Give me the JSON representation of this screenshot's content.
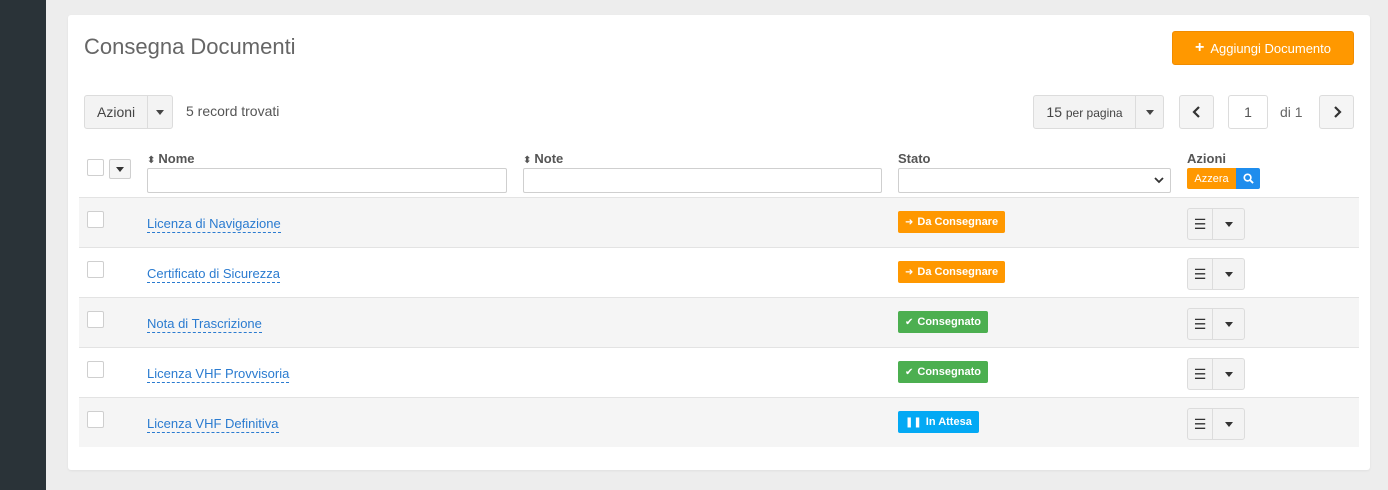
{
  "header": {
    "title": "Consegna Documenti",
    "add_button_label": "Aggiungi Documento"
  },
  "toolbar": {
    "actions_label": "Azioni",
    "records_text": "5 record trovati",
    "per_page_number": "15",
    "per_page_text": "per pagina",
    "page_value": "1",
    "page_of": "di 1"
  },
  "table": {
    "columns": {
      "name": "Nome",
      "note": "Note",
      "status": "Stato",
      "actions": "Azioni"
    },
    "reset_label": "Azzera",
    "rows": [
      {
        "name": "Licenza di Navigazione",
        "status": "Da Consegnare",
        "status_type": "pending"
      },
      {
        "name": "Certificato di Sicurezza",
        "status": "Da Consegnare",
        "status_type": "pending"
      },
      {
        "name": "Nota di Trascrizione",
        "status": "Consegnato",
        "status_type": "done"
      },
      {
        "name": "Licenza VHF Provvisoria",
        "status": "Consegnato",
        "status_type": "done"
      },
      {
        "name": "Licenza VHF Definitiva",
        "status": "In Attesa",
        "status_type": "waiting"
      }
    ]
  },
  "colors": {
    "pending": "#ff9800",
    "done": "#4caf50",
    "waiting": "#03a9f4",
    "link": "#2a7bd0",
    "sidebar": "#2a3338"
  },
  "icons": {
    "pending": "sign-in-icon",
    "done": "check-circle-icon",
    "waiting": "pause-icon"
  }
}
